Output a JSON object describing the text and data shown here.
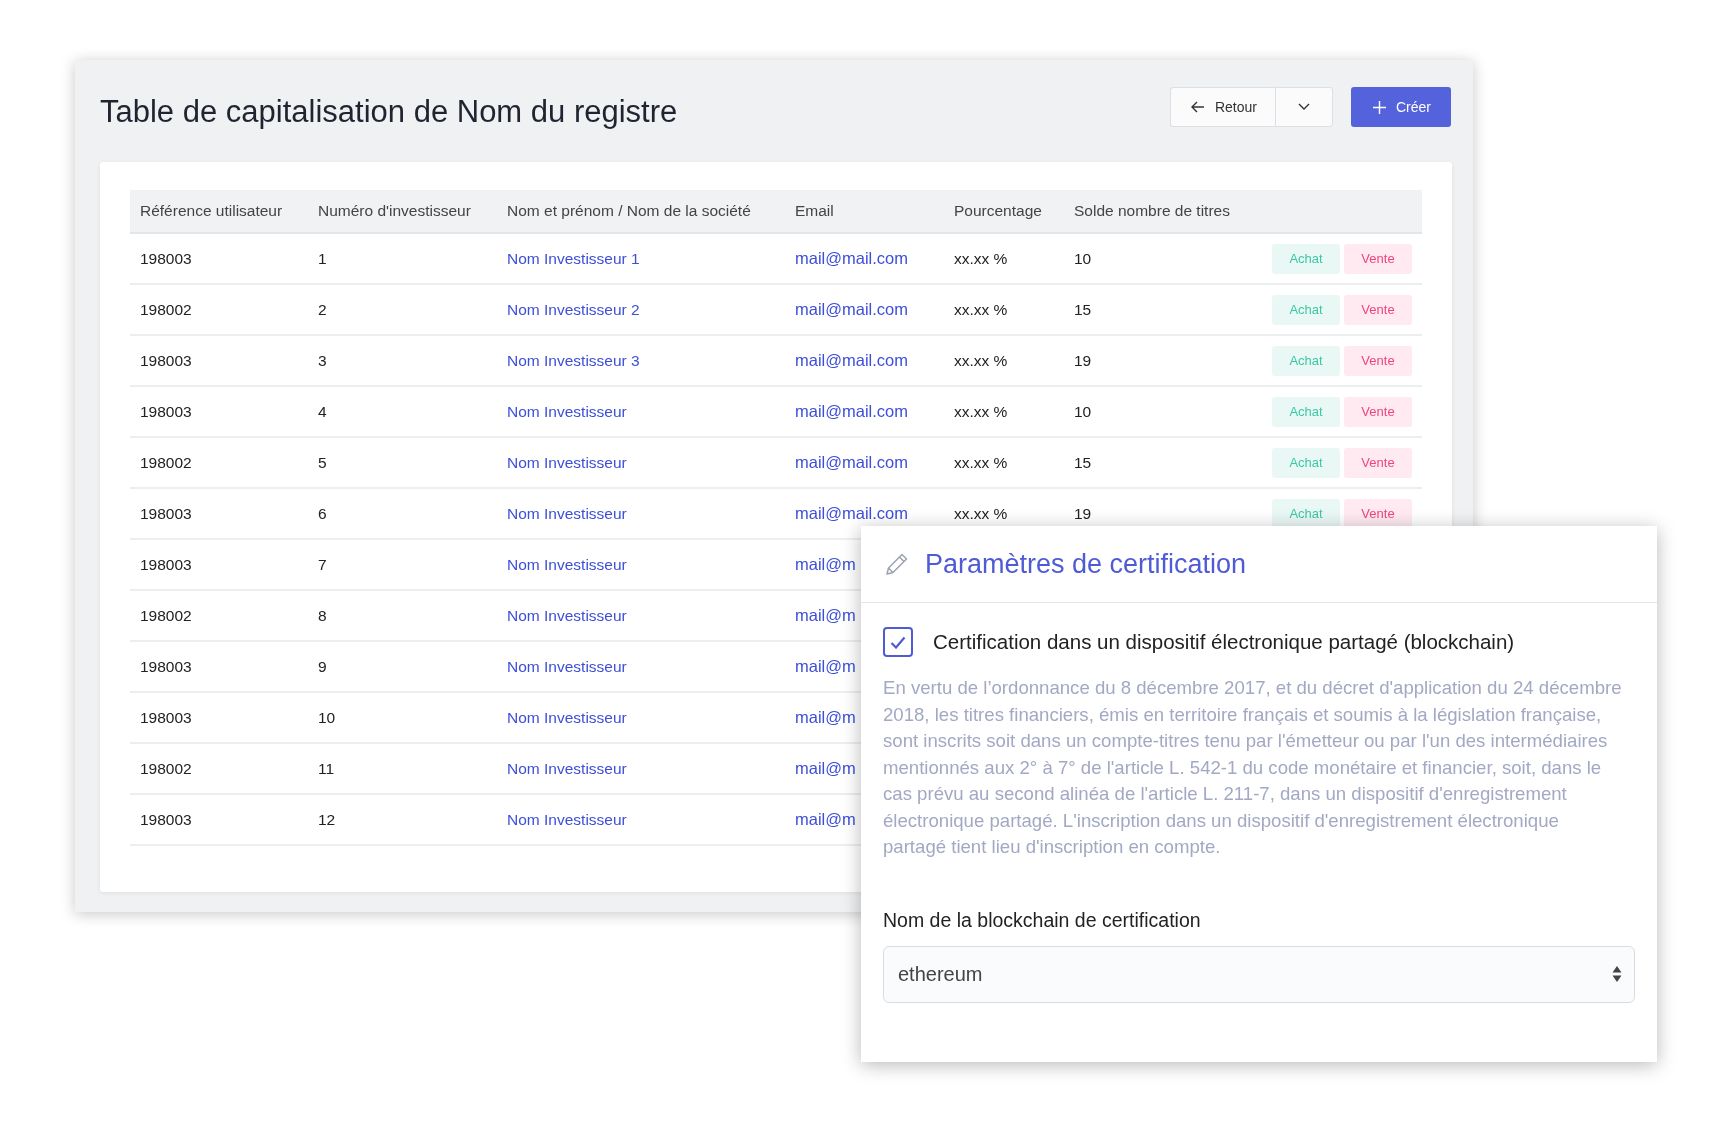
{
  "page": {
    "title": "Table de capitalisation de Nom du registre",
    "buttons": [
      {
        "kind": "back",
        "label": "Retour"
      },
      {
        "kind": "menu"
      },
      {
        "kind": "create",
        "label": "Créer"
      }
    ]
  },
  "table": {
    "columns": [
      "Référence utilisateur",
      "Numéro d'investisseur",
      "Nom et prénom / Nom de la société",
      "Email",
      "Pourcentage",
      "Solde nombre de titres"
    ],
    "rows": [
      {
        "reference": "198003",
        "number": "1",
        "name": "Nom Investisseur 1",
        "email": "mail@mail.com",
        "percentage": "xx.xx %",
        "balance": "10",
        "actions": [
          {
            "kind": "buy",
            "label": "Achat"
          },
          {
            "kind": "sell",
            "label": "Vente"
          }
        ]
      },
      {
        "reference": "198002",
        "number": "2",
        "name": "Nom Investisseur 2",
        "email": "mail@mail.com",
        "percentage": "xx.xx %",
        "balance": "15",
        "actions": [
          {
            "kind": "buy",
            "label": "Achat"
          },
          {
            "kind": "sell",
            "label": "Vente"
          }
        ]
      },
      {
        "reference": "198003",
        "number": "3",
        "name": "Nom Investisseur 3",
        "email": "mail@mail.com",
        "percentage": "xx.xx %",
        "balance": "19",
        "actions": [
          {
            "kind": "buy",
            "label": "Achat"
          },
          {
            "kind": "sell",
            "label": "Vente"
          }
        ]
      },
      {
        "reference": "198003",
        "number": "4",
        "name": "Nom Investisseur",
        "email": "mail@mail.com",
        "percentage": "xx.xx %",
        "balance": "10",
        "actions": [
          {
            "kind": "buy",
            "label": "Achat"
          },
          {
            "kind": "sell",
            "label": "Vente"
          }
        ]
      },
      {
        "reference": "198002",
        "number": "5",
        "name": "Nom Investisseur",
        "email": "mail@mail.com",
        "percentage": "xx.xx %",
        "balance": "15",
        "actions": [
          {
            "kind": "buy",
            "label": "Achat"
          },
          {
            "kind": "sell",
            "label": "Vente"
          }
        ]
      },
      {
        "reference": "198003",
        "number": "6",
        "name": "Nom Investisseur",
        "email": "mail@mail.com",
        "percentage": "xx.xx %",
        "balance": "19",
        "actions": [
          {
            "kind": "buy",
            "label": "Achat"
          },
          {
            "kind": "sell",
            "label": "Vente"
          }
        ]
      },
      {
        "reference": "198003",
        "number": "7",
        "name": "Nom Investisseur",
        "email": "mail@m"
      },
      {
        "reference": "198002",
        "number": "8",
        "name": "Nom Investisseur",
        "email": "mail@m"
      },
      {
        "reference": "198003",
        "number": "9",
        "name": "Nom Investisseur",
        "email": "mail@m"
      },
      {
        "reference": "198003",
        "number": "10",
        "name": "Nom Investisseur",
        "email": "mail@m"
      },
      {
        "reference": "198002",
        "number": "11",
        "name": "Nom Investisseur",
        "email": "mail@m"
      },
      {
        "reference": "198003",
        "number": "12",
        "name": "Nom Investisseur",
        "email": "mail@m"
      }
    ]
  },
  "dialog": {
    "title": "Paramètres de certification",
    "checkbox": {
      "label": "Certification dans un dispositif électronique partagé (blockchain)",
      "checked": true
    },
    "notice": "En vertu de l’ordonnance du 8 décembre 2017, et du décret d'application du 24 décembre 2018, les titres financiers, émis en territoire français et soumis à la législation française, sont inscrits soit dans un compte-titres tenu par l'émetteur ou par l'un des intermédiaires mentionnés aux 2° à 7° de l'article L. 542-1 du code monétaire et financier, soit, dans le cas prévu au second alinéa de l'article L. 211-7, dans un dispositif d'enregistrement électronique partagé. L'inscription dans un dispositif d'enregistrement électronique partagé tient lieu d'inscription en compte.",
    "field": {
      "label": "Nom de la blockchain de certification",
      "value": "ethereum"
    }
  }
}
